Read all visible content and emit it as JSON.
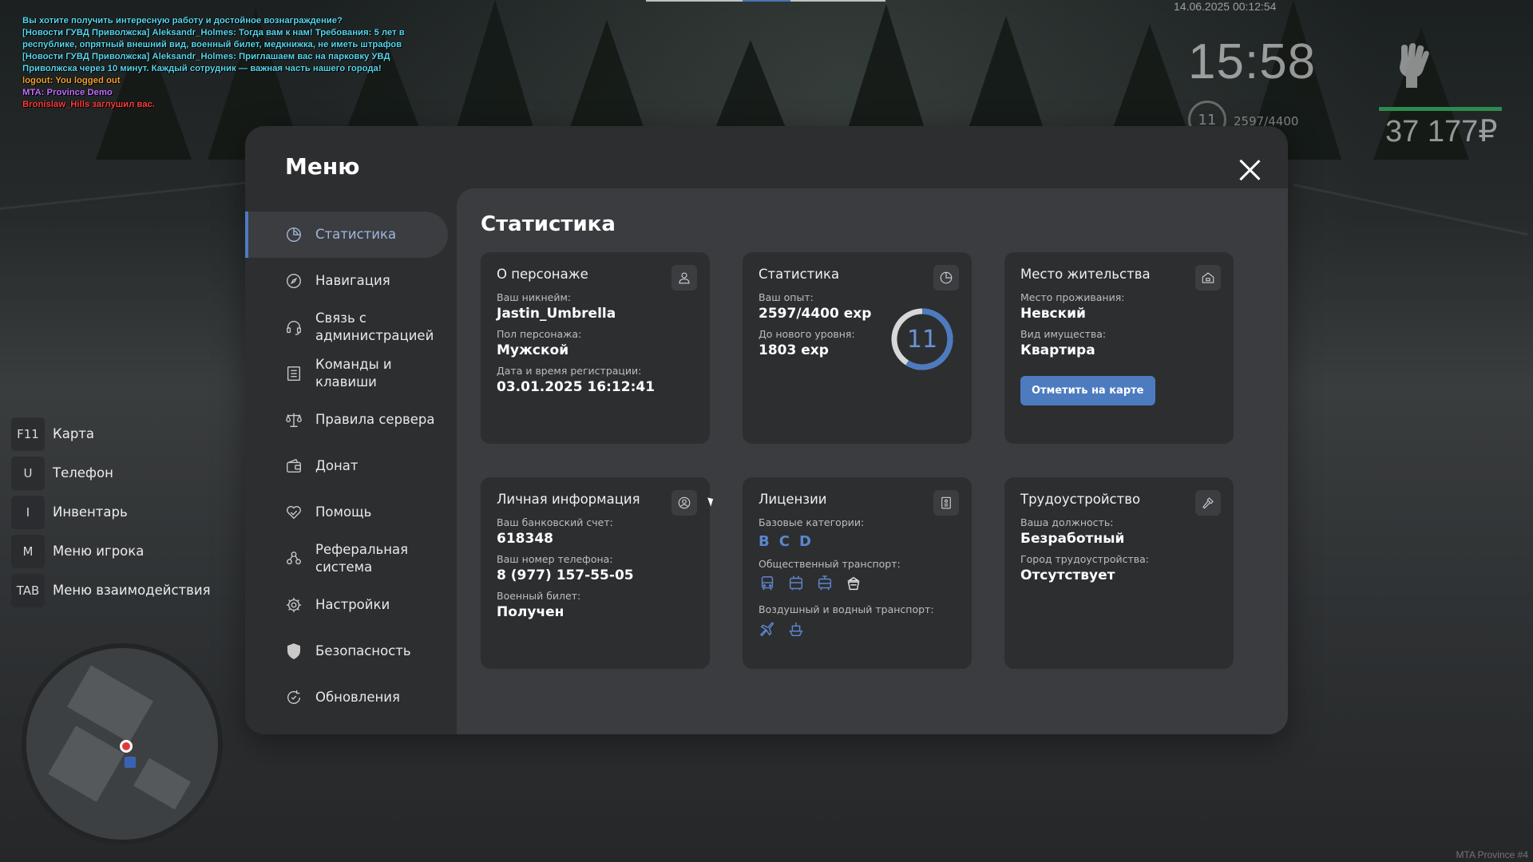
{
  "chat": [
    {
      "text": " Вы хотите получить интересную работу и достойное вознаграждение?",
      "color": "#57d6ee"
    },
    {
      "text": "[Новости ГУВД Приволжска] Aleksandr_Holmes: Тогда вам к нам! Требования: 5 лет в республике, опрятный внешний вид, военный билет, медкнижка, не иметь штрафов",
      "color": "#57d6ee"
    },
    {
      "text": "[Новости ГУВД Приволжска] Aleksandr_Holmes: Приглашаем вас на парковку УВД Приволжска через 10 минут. Каждый сотрудник — важная часть нашего города!",
      "color": "#57d6ee"
    },
    {
      "text": "logout: You logged out",
      "color": "#f2a233"
    },
    {
      "text": "MTA: Province Demo",
      "color": "#c46dff"
    },
    {
      "text": "Bronislaw_Hills заглушил вас.",
      "color": "#ff3b3b"
    }
  ],
  "hud": {
    "date": "14.06.2025 00:12:54",
    "clock": "15:58",
    "level": "11",
    "exp": "2597/4400",
    "money": "37 177₽"
  },
  "hotkeys": [
    {
      "key": "F11",
      "label": "Карта"
    },
    {
      "key": "U",
      "label": "Телефон"
    },
    {
      "key": "I",
      "label": "Инвентарь"
    },
    {
      "key": "M",
      "label": "Меню игрока"
    },
    {
      "key": "TAB",
      "label": "Меню взаимодействия"
    }
  ],
  "watermark": "MTA Province #4",
  "menu": {
    "title": "Меню",
    "nav": [
      {
        "label": "Статистика",
        "icon": "pie-chart-icon",
        "active": true
      },
      {
        "label": "Навигация",
        "icon": "compass-icon"
      },
      {
        "label": "Связь с администрацией",
        "icon": "headset-icon"
      },
      {
        "label": "Команды и клавиши",
        "icon": "list-icon"
      },
      {
        "label": "Правила сервера",
        "icon": "scales-icon"
      },
      {
        "label": "Донат",
        "icon": "wallet-icon"
      },
      {
        "label": "Помощь",
        "icon": "handshake-icon"
      },
      {
        "label": "Реферальная система",
        "icon": "people-icon"
      },
      {
        "label": "Настройки",
        "icon": "gear-icon"
      },
      {
        "label": "Безопасность",
        "icon": "shield-icon"
      },
      {
        "label": "Обновления",
        "icon": "refresh-icon"
      }
    ],
    "content_title": "Статистика",
    "cards": {
      "character": {
        "title": "О персонаже",
        "nick_label": "Ваш никнейм:",
        "nick": "Jastin_Umbrella",
        "gender_label": "Пол персонажа:",
        "gender": "Мужской",
        "reg_label": "Дата и время регистрации:",
        "reg": "03.01.2025 16:12:41"
      },
      "stats": {
        "title": "Статистика",
        "exp_label": "Ваш опыт:",
        "exp": "2597/4400 exp",
        "next_label": "До нового уровня:",
        "next": "1803 exp",
        "level": "11",
        "progress": 0.59
      },
      "residence": {
        "title": "Место жительства",
        "place_label": "Место проживания:",
        "place": "Невский",
        "type_label": "Вид имущества:",
        "type": "Квартира",
        "button": "Отметить на карте"
      },
      "personal": {
        "title": "Личная информация",
        "bank_label": "Ваш банковский счет:",
        "bank": "618348",
        "phone_label": "Ваш номер телефона:",
        "phone": "8 (977) 157-55-05",
        "military_label": "Военный билет:",
        "military": "Получен"
      },
      "licenses": {
        "title": "Лицензии",
        "basic_label": "Базовые категории:",
        "basic": [
          "B",
          "C",
          "D"
        ],
        "public_label": "Общественный транспорт:",
        "air_label": "Воздушный и водный транспорт:"
      },
      "employment": {
        "title": "Трудоустройство",
        "position_label": "Ваша должность:",
        "position": "Безработный",
        "city_label": "Город трудоустройства:",
        "city": "Отсутствует"
      }
    }
  },
  "colors": {
    "accent": "#4d7bc0",
    "panel": "#2d2e30",
    "content": "#3b3c3f"
  }
}
